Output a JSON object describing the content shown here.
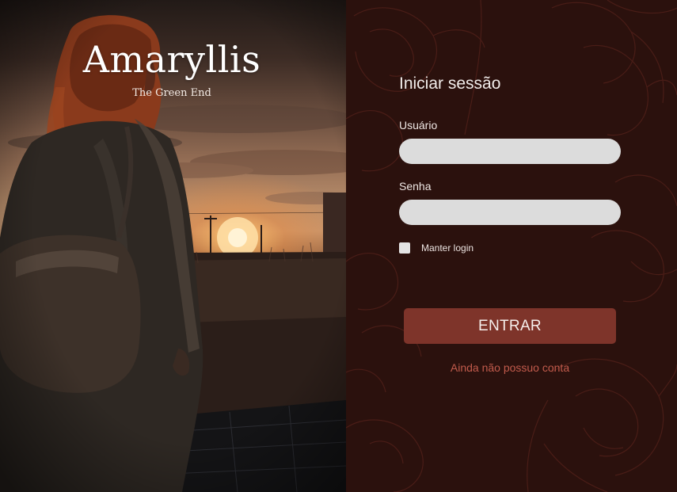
{
  "brand": {
    "title": "Amaryllis",
    "subtitle": "The Green End"
  },
  "hero_image": {
    "description_icon": "woman-at-sunset-illustration"
  },
  "login": {
    "heading": "Iniciar sessão",
    "username_label": "Usuário",
    "username_value": "",
    "password_label": "Senha",
    "password_value": "",
    "remember_label": "Manter login",
    "remember_checked": false,
    "submit_label": "ENTRAR",
    "signup_link": "Ainda não possuo conta"
  },
  "colors": {
    "panel_background": "#2b110d",
    "input_background": "#dcdcdc",
    "button_background": "#7e342a",
    "link_color": "#c25b4c",
    "floral_line": "#4a1d17"
  }
}
